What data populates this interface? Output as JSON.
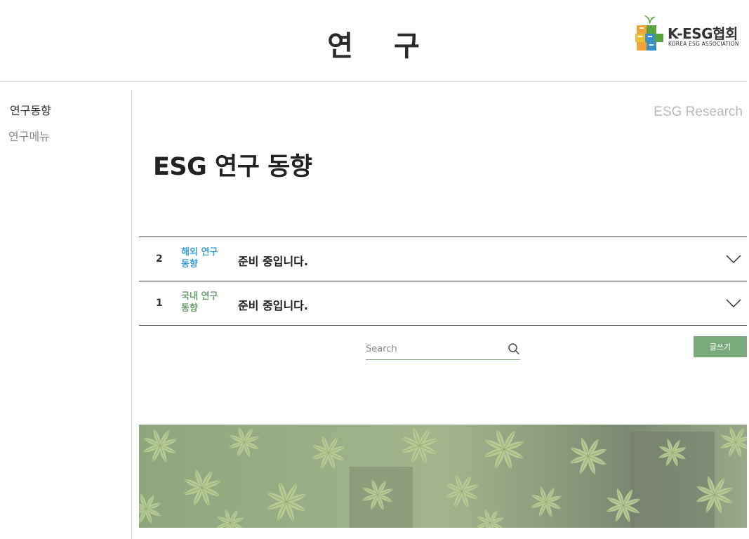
{
  "header": {
    "title": "연 구",
    "logo": {
      "name": "K-ESG협회",
      "subtitle": "KOREA ESG ASSOCIATION",
      "colors": {
        "green": "#5aa33c",
        "orange": "#f0a33a",
        "blue": "#3a8fc7",
        "yellow": "#e9c13a"
      }
    }
  },
  "sidebar": {
    "items": [
      {
        "label": "연구동향",
        "active": true
      },
      {
        "label": "연구메뉴",
        "active": false
      }
    ]
  },
  "main": {
    "eng_title": "ESG Research",
    "section_title": "ESG 연구 동향",
    "rows": [
      {
        "num": "2",
        "category": "해외 연구 동향",
        "category_color": "#3aa0d8",
        "title": "준비 중입니다."
      },
      {
        "num": "1",
        "category": "국내 연구 동향",
        "category_color": "#6a9e6c",
        "title": "준비 중입니다."
      }
    ],
    "search": {
      "placeholder": "Search",
      "value": ""
    },
    "write_button": "글쓰기",
    "accent_color": "#7aaa7c"
  }
}
